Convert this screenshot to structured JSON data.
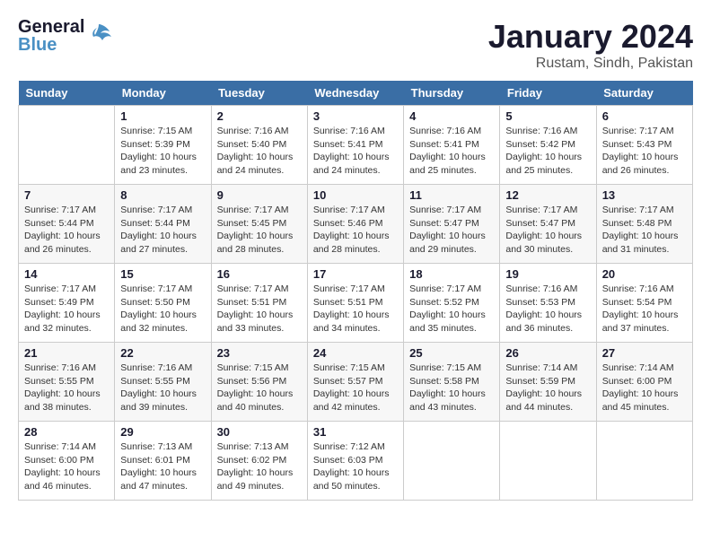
{
  "header": {
    "logo_general": "General",
    "logo_blue": "Blue",
    "month_title": "January 2024",
    "location": "Rustam, Sindh, Pakistan"
  },
  "days_of_week": [
    "Sunday",
    "Monday",
    "Tuesday",
    "Wednesday",
    "Thursday",
    "Friday",
    "Saturday"
  ],
  "weeks": [
    [
      {
        "day": "",
        "sunrise": "",
        "sunset": "",
        "daylight": ""
      },
      {
        "day": "1",
        "sunrise": "7:15 AM",
        "sunset": "5:39 PM",
        "daylight": "10 hours and 23 minutes."
      },
      {
        "day": "2",
        "sunrise": "7:16 AM",
        "sunset": "5:40 PM",
        "daylight": "10 hours and 24 minutes."
      },
      {
        "day": "3",
        "sunrise": "7:16 AM",
        "sunset": "5:41 PM",
        "daylight": "10 hours and 24 minutes."
      },
      {
        "day": "4",
        "sunrise": "7:16 AM",
        "sunset": "5:41 PM",
        "daylight": "10 hours and 25 minutes."
      },
      {
        "day": "5",
        "sunrise": "7:16 AM",
        "sunset": "5:42 PM",
        "daylight": "10 hours and 25 minutes."
      },
      {
        "day": "6",
        "sunrise": "7:17 AM",
        "sunset": "5:43 PM",
        "daylight": "10 hours and 26 minutes."
      }
    ],
    [
      {
        "day": "7",
        "sunrise": "7:17 AM",
        "sunset": "5:44 PM",
        "daylight": "10 hours and 26 minutes."
      },
      {
        "day": "8",
        "sunrise": "7:17 AM",
        "sunset": "5:44 PM",
        "daylight": "10 hours and 27 minutes."
      },
      {
        "day": "9",
        "sunrise": "7:17 AM",
        "sunset": "5:45 PM",
        "daylight": "10 hours and 28 minutes."
      },
      {
        "day": "10",
        "sunrise": "7:17 AM",
        "sunset": "5:46 PM",
        "daylight": "10 hours and 28 minutes."
      },
      {
        "day": "11",
        "sunrise": "7:17 AM",
        "sunset": "5:47 PM",
        "daylight": "10 hours and 29 minutes."
      },
      {
        "day": "12",
        "sunrise": "7:17 AM",
        "sunset": "5:47 PM",
        "daylight": "10 hours and 30 minutes."
      },
      {
        "day": "13",
        "sunrise": "7:17 AM",
        "sunset": "5:48 PM",
        "daylight": "10 hours and 31 minutes."
      }
    ],
    [
      {
        "day": "14",
        "sunrise": "7:17 AM",
        "sunset": "5:49 PM",
        "daylight": "10 hours and 32 minutes."
      },
      {
        "day": "15",
        "sunrise": "7:17 AM",
        "sunset": "5:50 PM",
        "daylight": "10 hours and 32 minutes."
      },
      {
        "day": "16",
        "sunrise": "7:17 AM",
        "sunset": "5:51 PM",
        "daylight": "10 hours and 33 minutes."
      },
      {
        "day": "17",
        "sunrise": "7:17 AM",
        "sunset": "5:51 PM",
        "daylight": "10 hours and 34 minutes."
      },
      {
        "day": "18",
        "sunrise": "7:17 AM",
        "sunset": "5:52 PM",
        "daylight": "10 hours and 35 minutes."
      },
      {
        "day": "19",
        "sunrise": "7:16 AM",
        "sunset": "5:53 PM",
        "daylight": "10 hours and 36 minutes."
      },
      {
        "day": "20",
        "sunrise": "7:16 AM",
        "sunset": "5:54 PM",
        "daylight": "10 hours and 37 minutes."
      }
    ],
    [
      {
        "day": "21",
        "sunrise": "7:16 AM",
        "sunset": "5:55 PM",
        "daylight": "10 hours and 38 minutes."
      },
      {
        "day": "22",
        "sunrise": "7:16 AM",
        "sunset": "5:55 PM",
        "daylight": "10 hours and 39 minutes."
      },
      {
        "day": "23",
        "sunrise": "7:15 AM",
        "sunset": "5:56 PM",
        "daylight": "10 hours and 40 minutes."
      },
      {
        "day": "24",
        "sunrise": "7:15 AM",
        "sunset": "5:57 PM",
        "daylight": "10 hours and 42 minutes."
      },
      {
        "day": "25",
        "sunrise": "7:15 AM",
        "sunset": "5:58 PM",
        "daylight": "10 hours and 43 minutes."
      },
      {
        "day": "26",
        "sunrise": "7:14 AM",
        "sunset": "5:59 PM",
        "daylight": "10 hours and 44 minutes."
      },
      {
        "day": "27",
        "sunrise": "7:14 AM",
        "sunset": "6:00 PM",
        "daylight": "10 hours and 45 minutes."
      }
    ],
    [
      {
        "day": "28",
        "sunrise": "7:14 AM",
        "sunset": "6:00 PM",
        "daylight": "10 hours and 46 minutes."
      },
      {
        "day": "29",
        "sunrise": "7:13 AM",
        "sunset": "6:01 PM",
        "daylight": "10 hours and 47 minutes."
      },
      {
        "day": "30",
        "sunrise": "7:13 AM",
        "sunset": "6:02 PM",
        "daylight": "10 hours and 49 minutes."
      },
      {
        "day": "31",
        "sunrise": "7:12 AM",
        "sunset": "6:03 PM",
        "daylight": "10 hours and 50 minutes."
      },
      {
        "day": "",
        "sunrise": "",
        "sunset": "",
        "daylight": ""
      },
      {
        "day": "",
        "sunrise": "",
        "sunset": "",
        "daylight": ""
      },
      {
        "day": "",
        "sunrise": "",
        "sunset": "",
        "daylight": ""
      }
    ]
  ],
  "labels": {
    "sunrise": "Sunrise:",
    "sunset": "Sunset:",
    "daylight": "Daylight:"
  }
}
